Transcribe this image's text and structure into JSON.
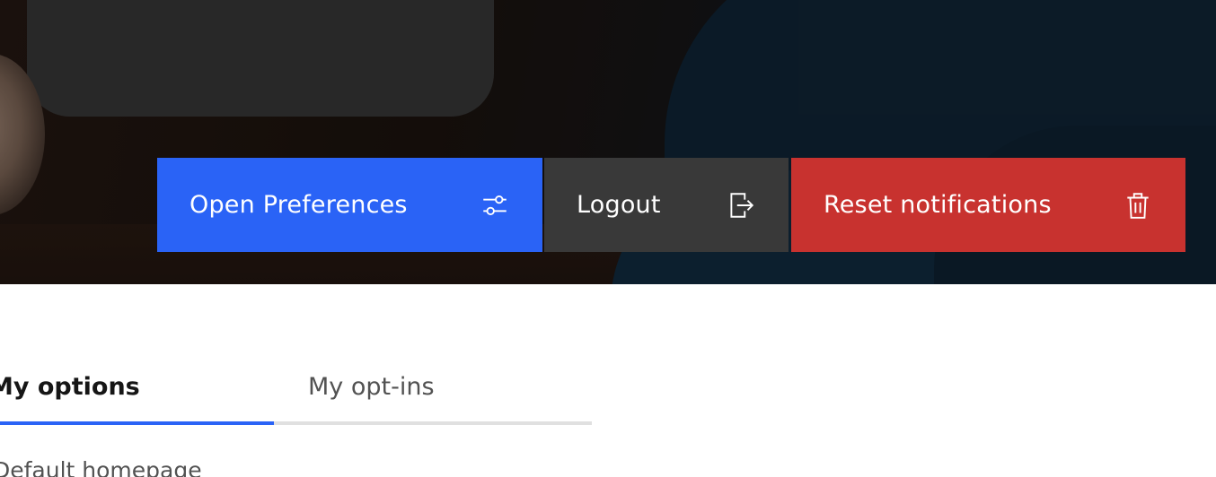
{
  "actions": {
    "open_preferences": {
      "label": "Open Preferences",
      "icon": "sliders-icon",
      "color": "#2a63f6"
    },
    "logout": {
      "label": "Logout",
      "icon": "logout-icon",
      "color": "#393939"
    },
    "reset_notifications": {
      "label": "Reset notifications",
      "icon": "trash-icon",
      "color": "#c8322f"
    }
  },
  "tabs": [
    {
      "label": "My options",
      "selected": true
    },
    {
      "label": "My opt-ins",
      "selected": false
    }
  ],
  "content": {
    "first_field_label": "Default homepage"
  },
  "colors": {
    "accent": "#2a63f6",
    "tab_inactive_border": "#e0e0e0"
  }
}
